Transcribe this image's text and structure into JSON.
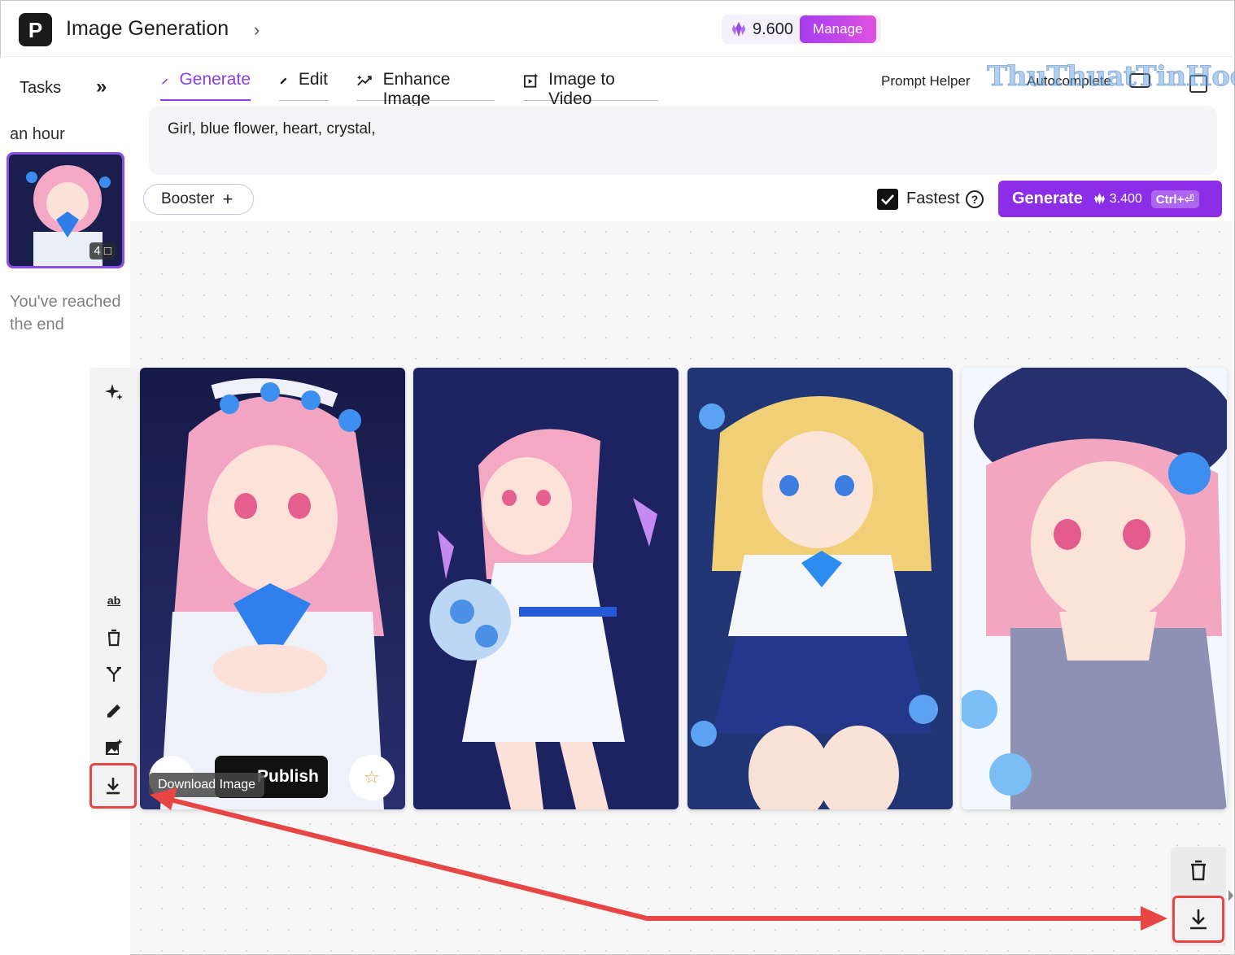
{
  "header": {
    "app_title": "Image Generation",
    "credits": "9.600",
    "manage_label": "Manage"
  },
  "sidebar": {
    "tasks_label": "Tasks",
    "time_label": "an hour",
    "thumbnail_count": "4",
    "end_text": "You've reached the end"
  },
  "tabs": [
    {
      "label": "Generate",
      "active": true
    },
    {
      "label": "Edit",
      "active": false
    },
    {
      "label": "Enhance Image",
      "active": false
    },
    {
      "label": "Image to Video",
      "active": false
    }
  ],
  "prompt_helper_label": "Prompt Helper",
  "autocomplete_label": "Autocomplete",
  "watermark": "ThuThuatTinHoc.vn",
  "prompt": {
    "text": "Girl, blue flower, heart, crystal,"
  },
  "controls": {
    "booster_label": "Booster",
    "fastest_label": "Fastest",
    "fastest_checked": true,
    "generate_label": "Generate",
    "generate_cost": "3.400",
    "generate_shortcut": "Ctrl+⏎"
  },
  "image_toolbar": {
    "download_tooltip": "Download Image",
    "publish_label": "Publish"
  },
  "images": [
    {
      "description_icon": "anime-girl-pink-hair-crystal-heart"
    },
    {
      "description_icon": "anime-girl-pink-hair-bouquet"
    },
    {
      "description_icon": "anime-girl-blonde-hair-heart"
    },
    {
      "description_icon": "anime-girl-pink-hair-beret"
    }
  ],
  "colors": {
    "accent": "#8c2de8",
    "highlight": "#e84545"
  }
}
